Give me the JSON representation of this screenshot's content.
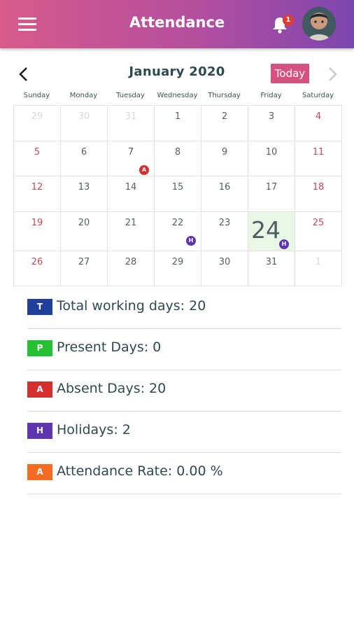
{
  "header": {
    "title": "Attendance",
    "notification_count": "1",
    "menu_icon": "hamburger-menu-icon",
    "bell_icon": "bell-icon",
    "avatar": "user-avatar-photo",
    "gradient": [
      "#d85a8a",
      "#7e46b0"
    ]
  },
  "calendar": {
    "month_title": "January 2020",
    "today_label": "Today",
    "weekdays": [
      "Sunday",
      "Monday",
      "Tuesday",
      "Wednesday",
      "Thursday",
      "Friday",
      "Saturday"
    ],
    "weeks": [
      [
        {
          "day": "29",
          "muted": true
        },
        {
          "day": "30",
          "muted": true
        },
        {
          "day": "31",
          "muted": true
        },
        {
          "day": "1"
        },
        {
          "day": "2"
        },
        {
          "day": "3"
        },
        {
          "day": "4",
          "weekend": true
        }
      ],
      [
        {
          "day": "5",
          "weekend": true
        },
        {
          "day": "6"
        },
        {
          "day": "7",
          "mark": "A"
        },
        {
          "day": "8"
        },
        {
          "day": "9"
        },
        {
          "day": "10"
        },
        {
          "day": "11",
          "weekend": true
        }
      ],
      [
        {
          "day": "12",
          "weekend": true
        },
        {
          "day": "13"
        },
        {
          "day": "14"
        },
        {
          "day": "15"
        },
        {
          "day": "16"
        },
        {
          "day": "17"
        },
        {
          "day": "18",
          "weekend": true
        }
      ],
      [
        {
          "day": "19",
          "weekend": true
        },
        {
          "day": "20"
        },
        {
          "day": "21"
        },
        {
          "day": "22",
          "mark": "H"
        },
        {
          "day": "23"
        },
        {
          "day": "24",
          "today": true,
          "mark": "H"
        },
        {
          "day": "25",
          "weekend": true
        }
      ],
      [
        {
          "day": "26",
          "weekend": true
        },
        {
          "day": "27"
        },
        {
          "day": "28"
        },
        {
          "day": "29"
        },
        {
          "day": "30"
        },
        {
          "day": "31"
        },
        {
          "day": "1",
          "muted": true
        }
      ]
    ],
    "mark_colors": {
      "A": "#d32f2f",
      "H": "#5e35b1"
    }
  },
  "summary": [
    {
      "badge": "T",
      "color": "#1f3f9a",
      "label": "Total working days: 20"
    },
    {
      "badge": "P",
      "color": "#25c132",
      "label": "Present Days: 0"
    },
    {
      "badge": "A",
      "color": "#d32f2f",
      "label": "Absent Days: 20"
    },
    {
      "badge": "H",
      "color": "#5e35b1",
      "label": "Holidays: 2"
    },
    {
      "badge": "A",
      "color": "#f26b21",
      "label": "Attendance Rate: 0.00 %"
    }
  ]
}
